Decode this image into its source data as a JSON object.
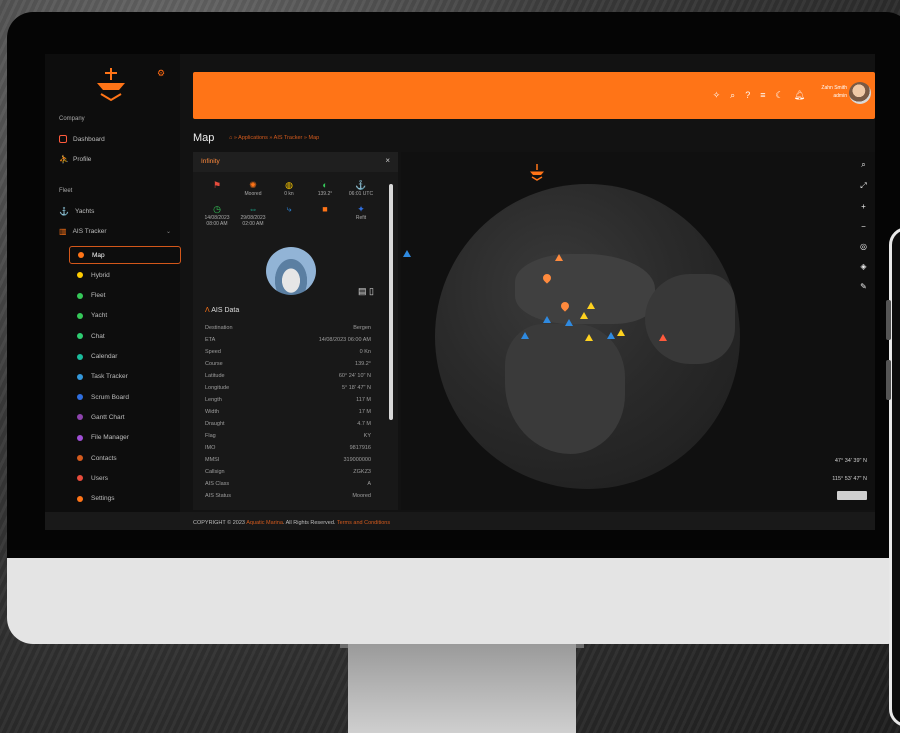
{
  "app": {
    "title": "Map",
    "breadcrumb": [
      "Applications",
      "AIS Tracker",
      "Map"
    ],
    "footer": {
      "prefix": "COPYRIGHT © 2023",
      "brand": "Aquatic Marina",
      "mid": ". All Rights Reserved.",
      "link": "Terms and Conditions"
    }
  },
  "header": {
    "user_name": "Zahn Smith",
    "user_role": "admin"
  },
  "sidebar": {
    "section_company": "Company",
    "company_items": [
      {
        "label": "Dashboard",
        "icon": "monitor-icon"
      },
      {
        "label": "Profile",
        "icon": "user-icon"
      }
    ],
    "section_fleet": "Fleet",
    "fleet_items": [
      {
        "label": "Yachts",
        "icon": "anchor-icon"
      },
      {
        "label": "AIS Tracker",
        "icon": "equalizer-icon"
      }
    ],
    "sub_items": [
      {
        "label": "Map",
        "color": "#ff7417"
      },
      {
        "label": "Hybrid",
        "color": "#ffcc00"
      },
      {
        "label": "Fleet",
        "color": "#35c759"
      },
      {
        "label": "Yacht",
        "color": "#35c759"
      },
      {
        "label": "Chat",
        "color": "#2ecc71"
      },
      {
        "label": "Calendar",
        "color": "#1abc9c"
      },
      {
        "label": "Task Tracker",
        "color": "#3498db"
      },
      {
        "label": "Scrum Board",
        "color": "#2f6fe0"
      },
      {
        "label": "Gantt Chart",
        "color": "#8e44ad"
      },
      {
        "label": "File Manager",
        "color": "#a04fd6"
      },
      {
        "label": "Contacts",
        "color": "#d35a1d"
      },
      {
        "label": "Users",
        "color": "#e74c3c"
      },
      {
        "label": "Settings",
        "color": "#ff7417"
      }
    ]
  },
  "vessel": {
    "name": "Infinity",
    "stats": [
      {
        "icon": "flag-icon",
        "value": ""
      },
      {
        "icon": "wheel-icon",
        "value": "Moored"
      },
      {
        "icon": "speed-icon",
        "value": "0 kn"
      },
      {
        "icon": "compass-icon",
        "value": "139.2°"
      },
      {
        "icon": "anchor-icon",
        "value": "06:01 UTC"
      },
      {
        "icon": "clock-icon",
        "value": "14/08/2023 08:00 AM"
      },
      {
        "icon": "eta-icon",
        "value": "29/08/2023 02:00 AM"
      },
      {
        "icon": "route-icon",
        "value": ""
      },
      {
        "icon": "status-square-icon",
        "value": ""
      },
      {
        "icon": "port-icon",
        "value": "Refit"
      }
    ]
  },
  "ais": {
    "title": "AIS Data",
    "rows": [
      {
        "k": "Destination",
        "v": "Bergen"
      },
      {
        "k": "ETA",
        "v": "14/08/2023 06:00 AM"
      },
      {
        "k": "Speed",
        "v": "0 Kn"
      },
      {
        "k": "Course",
        "v": "139.2°"
      },
      {
        "k": "Latitude",
        "v": "60° 24' 10\" N"
      },
      {
        "k": "Longitude",
        "v": "5° 18' 47\" N"
      },
      {
        "k": "Length",
        "v": "117 M"
      },
      {
        "k": "Width",
        "v": "17 M"
      },
      {
        "k": "Draught",
        "v": "4.7 M"
      },
      {
        "k": "Flag",
        "v": "KY"
      },
      {
        "k": "IMO",
        "v": "9817916"
      },
      {
        "k": "MMSI",
        "v": "319000000"
      },
      {
        "k": "Callsign",
        "v": "ZGKZ3"
      },
      {
        "k": "AIS Class",
        "v": "A"
      },
      {
        "k": "AIS Status",
        "v": "Moored"
      }
    ]
  },
  "map": {
    "coord_lat": "47° 34' 39\" N",
    "coord_lon": "115° 53' 47\" N",
    "tools": [
      "search-icon",
      "fullscreen-icon",
      "zoom-in-icon",
      "zoom-out-icon",
      "locate-icon",
      "layers-icon",
      "draw-icon"
    ]
  },
  "colors": {
    "accent": "#ff7417",
    "bg": "#121212"
  }
}
